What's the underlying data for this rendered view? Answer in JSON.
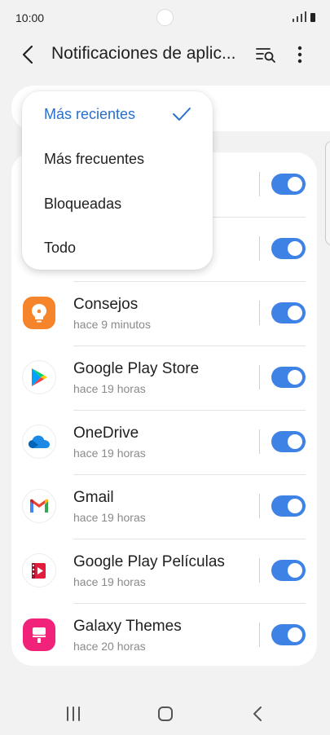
{
  "status_bar": {
    "time": "10:00"
  },
  "header": {
    "title": "Notificaciones de aplic..."
  },
  "dropdown": {
    "items": [
      {
        "label": "Más recientes",
        "selected": true
      },
      {
        "label": "Más frecuentes",
        "selected": false
      },
      {
        "label": "Bloqueadas",
        "selected": false
      },
      {
        "label": "Todo",
        "selected": false
      }
    ]
  },
  "apps": [
    {
      "name": "Consejos",
      "time": "hace 9 minutos",
      "icon": "tips-bulb-icon",
      "enabled": true
    },
    {
      "name": "Google Play Store",
      "time": "hace 19 horas",
      "icon": "play-store-icon",
      "enabled": true
    },
    {
      "name": "OneDrive",
      "time": "hace 19 horas",
      "icon": "onedrive-cloud-icon",
      "enabled": true
    },
    {
      "name": "Gmail",
      "time": "hace 19 horas",
      "icon": "gmail-icon",
      "enabled": true
    },
    {
      "name": "Google Play Películas",
      "time": "hace 19 horas",
      "icon": "play-movies-icon",
      "enabled": true
    },
    {
      "name": "Galaxy Themes",
      "time": "hace 20 horas",
      "icon": "galaxy-themes-icon",
      "enabled": true
    }
  ],
  "colors": {
    "accent": "#3e82e6",
    "selected_text": "#2a6fc9",
    "background": "#f2f2f2"
  }
}
